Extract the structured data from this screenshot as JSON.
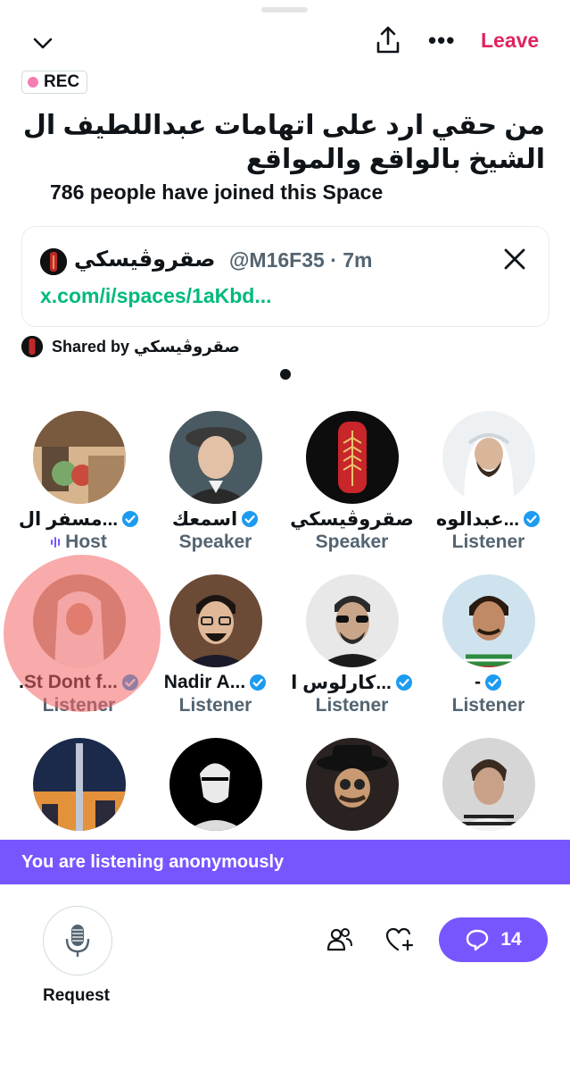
{
  "header": {
    "leave_label": "Leave",
    "rec_label": "REC",
    "colors": {
      "leave": "#e0245e",
      "rec_dot": "#f47eb2",
      "accent": "#7856ff",
      "link": "#00ba7c"
    }
  },
  "space": {
    "title": "من حقي ارد على اتهامات  عبداللطيف ال الشيخ بالواقع والمواقع",
    "joined_text": "786 people have joined this Space"
  },
  "tweet_card": {
    "name": "صقروڤيسكي",
    "handle": "@M16F35 · 7m",
    "link": "x.com/i/spaces/1aKbd...",
    "icon": "x-logo-icon"
  },
  "shared_by": {
    "label": "Shared by صقروڤيسكي"
  },
  "participants": [
    {
      "name": "مسفر ال...",
      "role": "Host",
      "verified": true
    },
    {
      "name": "اسمعك",
      "role": "Speaker",
      "verified": true
    },
    {
      "name": "صقروڤيسكي",
      "role": "Speaker",
      "verified": false
    },
    {
      "name": "عبدالوه...",
      "role": "Listener",
      "verified": true
    },
    {
      "name": ".St Dont f...",
      "role": "Listener",
      "verified": true
    },
    {
      "name": "Nadir A...",
      "role": "Listener",
      "verified": true
    },
    {
      "name": "كارلوس ا...",
      "role": "Listener",
      "verified": true
    },
    {
      "name": "-",
      "role": "Listener",
      "verified": true
    }
  ],
  "banner": {
    "text": "You are listening anonymously"
  },
  "bottom": {
    "request_label": "Request",
    "reply_count": "14"
  }
}
